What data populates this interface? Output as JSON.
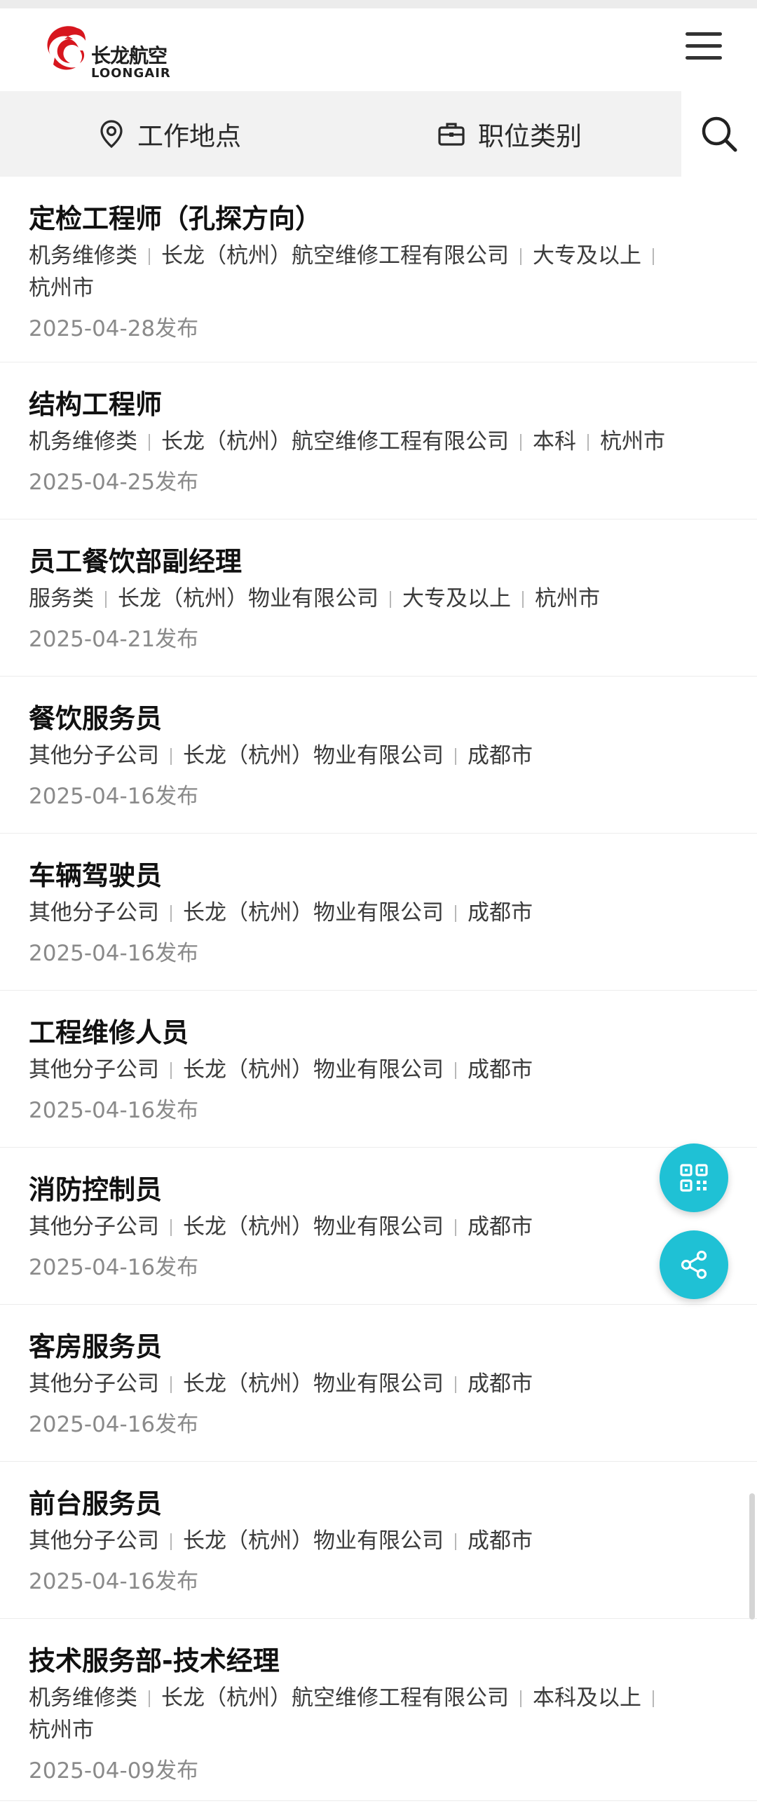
{
  "brand": {
    "name_cn": "长龙航空",
    "name_en": "LOONGAIR",
    "logo_color": "#d7161e"
  },
  "header": {
    "menu_icon": "hamburger-menu-icon"
  },
  "filters": {
    "location_label": "工作地点",
    "category_label": "职位类别",
    "location_icon": "location-pin-icon",
    "category_icon": "briefcase-icon",
    "search_icon": "search-icon"
  },
  "jobs": [
    {
      "title": "定检工程师（孔探方向）",
      "category": "机务维修类",
      "company": "长龙（杭州）航空维修工程有限公司",
      "education": "大专及以上",
      "city": "杭州市",
      "date": "2025-04-28发布"
    },
    {
      "title": "结构工程师",
      "category": "机务维修类",
      "company": "长龙（杭州）航空维修工程有限公司",
      "education": "本科",
      "city": "杭州市",
      "date": "2025-04-25发布"
    },
    {
      "title": "员工餐饮部副经理",
      "category": "服务类",
      "company": "长龙（杭州）物业有限公司",
      "education": "大专及以上",
      "city": "杭州市",
      "date": "2025-04-21发布"
    },
    {
      "title": "餐饮服务员",
      "category": "其他分子公司",
      "company": "长龙（杭州）物业有限公司",
      "education": "",
      "city": "成都市",
      "date": "2025-04-16发布"
    },
    {
      "title": "车辆驾驶员",
      "category": "其他分子公司",
      "company": "长龙（杭州）物业有限公司",
      "education": "",
      "city": "成都市",
      "date": "2025-04-16发布"
    },
    {
      "title": "工程维修人员",
      "category": "其他分子公司",
      "company": "长龙（杭州）物业有限公司",
      "education": "",
      "city": "成都市",
      "date": "2025-04-16发布"
    },
    {
      "title": "消防控制员",
      "category": "其他分子公司",
      "company": "长龙（杭州）物业有限公司",
      "education": "",
      "city": "成都市",
      "date": "2025-04-16发布"
    },
    {
      "title": "客房服务员",
      "category": "其他分子公司",
      "company": "长龙（杭州）物业有限公司",
      "education": "",
      "city": "成都市",
      "date": "2025-04-16发布"
    },
    {
      "title": "前台服务员",
      "category": "其他分子公司",
      "company": "长龙（杭州）物业有限公司",
      "education": "",
      "city": "成都市",
      "date": "2025-04-16发布"
    },
    {
      "title": "技术服务部-技术经理",
      "category": "机务维修类",
      "company": "长龙（杭州）航空维修工程有限公司",
      "education": "本科及以上",
      "city": "杭州市",
      "date": "2025-04-09发布"
    }
  ],
  "floating_actions": {
    "qr_icon": "qr-code-icon",
    "share_icon": "share-icon",
    "accent_color": "#1fc1d5"
  }
}
